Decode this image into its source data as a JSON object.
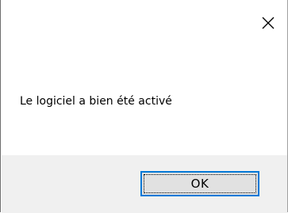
{
  "dialog": {
    "message": "Le logiciel a bien été activé",
    "close_icon": "close-icon",
    "ok_label": "OK"
  },
  "colors": {
    "background": "#ffffff",
    "footer": "#f0f0f0",
    "button_face": "#e1e1e1",
    "button_focus_border": "#0078d7",
    "text": "#000000"
  }
}
